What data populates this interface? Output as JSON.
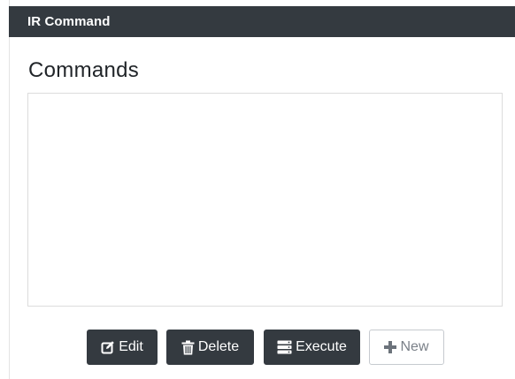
{
  "panel": {
    "title": "IR Command"
  },
  "commands": {
    "heading": "Commands",
    "items": []
  },
  "toolbar": {
    "edit_label": "Edit",
    "delete_label": "Delete",
    "execute_label": "Execute",
    "new_label": "New"
  },
  "icons": {
    "edit": "edit-icon",
    "delete": "trash-icon",
    "execute": "server-icon",
    "new": "plus-icon"
  },
  "colors": {
    "header_bg": "#343a40",
    "button_dark": "#343a40",
    "button_light_text": "#7a8088"
  }
}
